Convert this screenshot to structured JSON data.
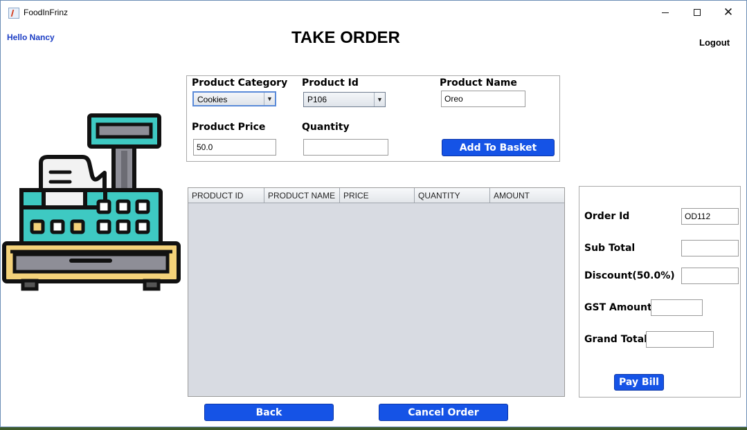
{
  "window": {
    "title": "FoodInFrinz",
    "close_glyph": "✕"
  },
  "header": {
    "greeting": "Hello Nancy",
    "title": "TAKE ORDER",
    "logout_label": "Logout"
  },
  "form": {
    "category_label": "Product Category",
    "category_value": "Cookies",
    "product_id_label": "Product Id",
    "product_id_value": "P106",
    "product_name_label": "Product Name",
    "product_name_value": "Oreo",
    "price_label": "Product Price",
    "price_value": "50.0",
    "quantity_label": "Quantity",
    "quantity_value": "",
    "add_button_label": "Add To Basket"
  },
  "table": {
    "columns": [
      "PRODUCT ID",
      "PRODUCT NAME",
      "PRICE",
      "QUANTITY",
      "AMOUNT"
    ],
    "rows": []
  },
  "bill": {
    "order_id_label": "Order Id",
    "order_id_value": "OD112",
    "sub_total_label": "Sub Total",
    "sub_total_value": "",
    "discount_label": "Discount(50.0%)",
    "discount_value": "",
    "gst_label": "GST Amount",
    "gst_value": "",
    "grand_total_label": "Grand Total",
    "grand_total_value": "",
    "pay_button_label": "Pay Bill"
  },
  "footer": {
    "back_label": "Back",
    "cancel_label": "Cancel Order"
  },
  "colors": {
    "button_blue": "#1553e6",
    "greeting_blue": "#1a3cc4",
    "register_teal": "#3ec9c2",
    "register_yellow": "#f4d27a"
  },
  "icons": [
    "java-app-icon",
    "cash-register-icon",
    "dropdown-arrow-icon"
  ]
}
